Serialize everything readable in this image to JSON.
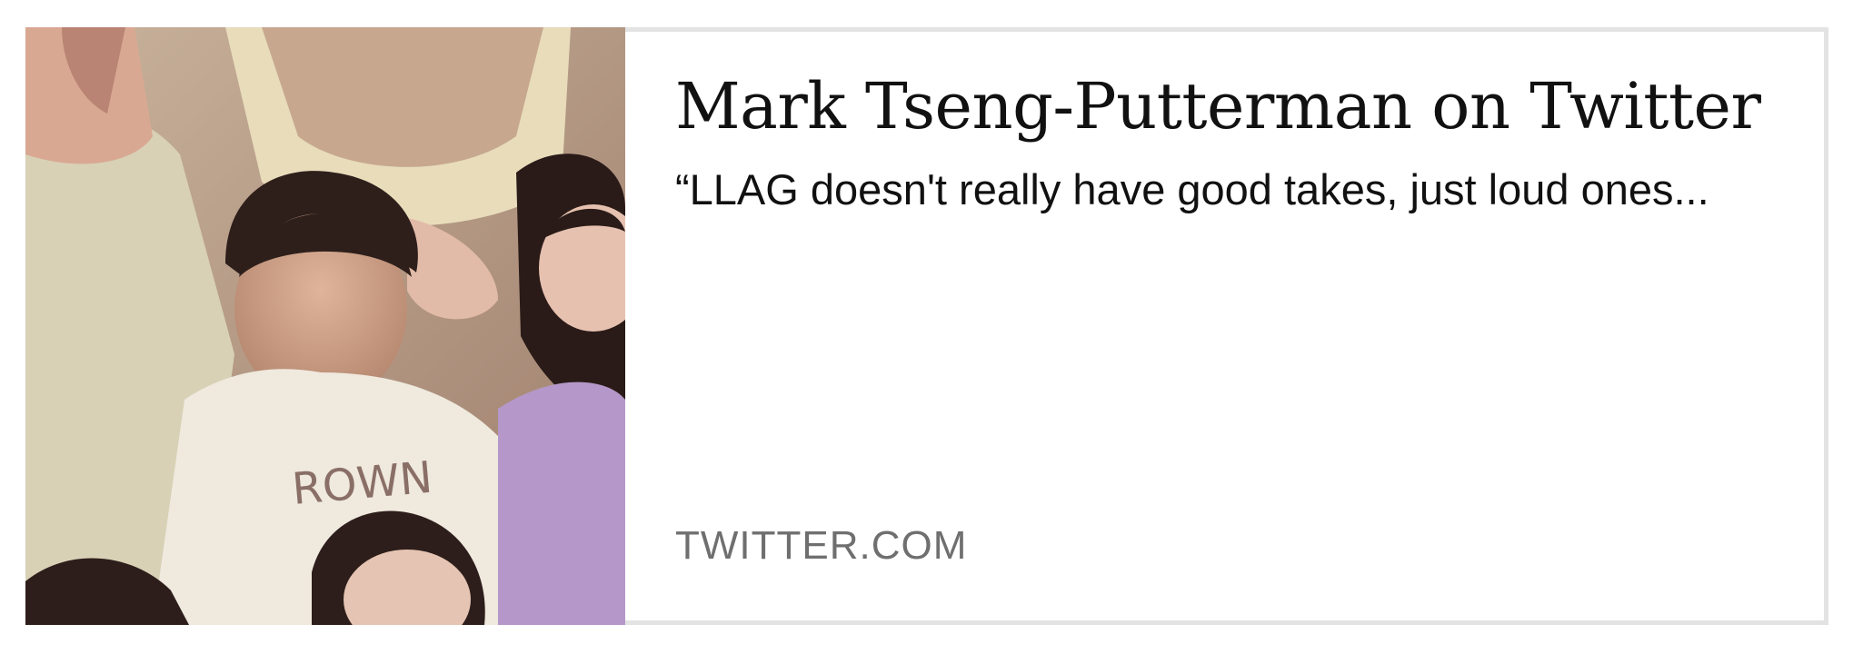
{
  "card": {
    "title": "Mark Tseng-Putterman on Twitter",
    "description": "“LLAG doesn't really have good takes, just loud ones...",
    "domain": "TWITTER.COM",
    "image": {
      "alt": "old family photo of children",
      "icon": "photo-thumbnail"
    }
  },
  "colors": {
    "border": "#e3e3e3",
    "title": "#111111",
    "description": "#111111",
    "domain": "#6f6f6f"
  }
}
